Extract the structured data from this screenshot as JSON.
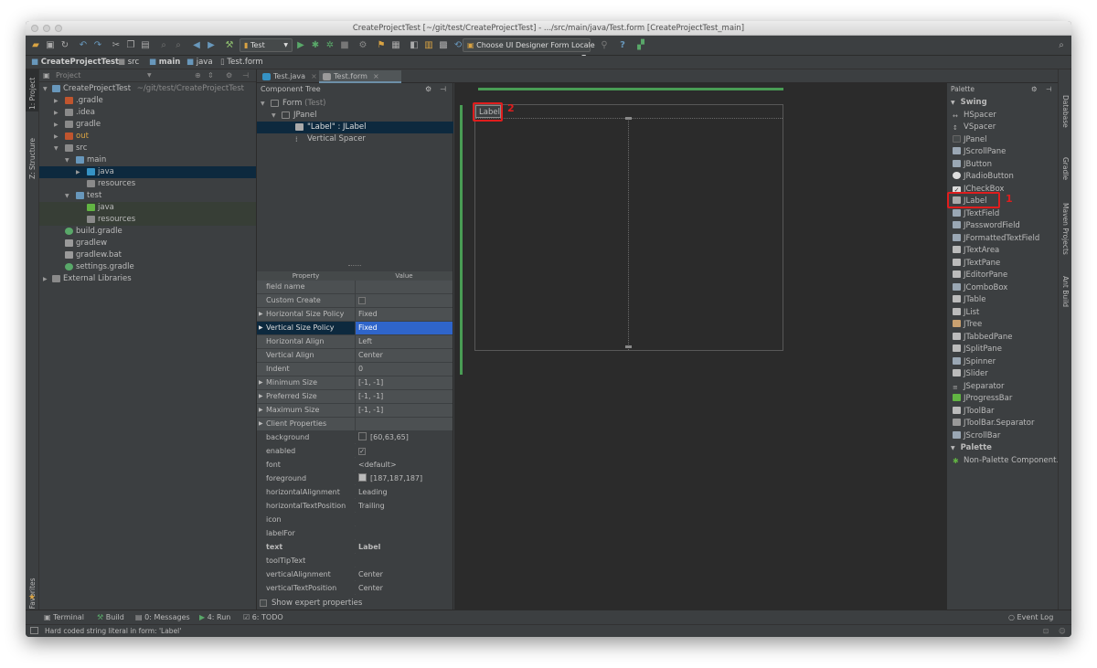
{
  "window": {
    "title": "CreateProjectTest [~/git/test/CreateProjectTest] - .../src/main/java/Test.form [CreateProjectTest_main]"
  },
  "toolbar": {
    "run_config": "Test",
    "locale_combo": "Choose UI Designer Form Locale"
  },
  "navbar": {
    "crumbs": [
      "CreateProjectTest",
      "src",
      "main",
      "java",
      "Test.form"
    ]
  },
  "left_strip": {
    "project": "1: Project",
    "structure": "Z: Structure",
    "favorites": "2: Favorites"
  },
  "right_strip": {
    "database": "Database",
    "gradle": "Gradle",
    "maven": "Maven Projects",
    "ant": "Ant Build"
  },
  "project": {
    "header": "Project",
    "root_name": "CreateProjectTest",
    "root_path": "~/git/test/CreateProjectTest",
    "items": [
      ".gradle",
      ".idea",
      "gradle",
      "out",
      "src",
      "main",
      "java",
      "resources",
      "test",
      "java",
      "resources",
      "build.gradle",
      "gradlew",
      "gradlew.bat",
      "settings.gradle",
      "External Libraries"
    ]
  },
  "tabs": [
    "Test.java",
    "Test.form"
  ],
  "component_tree": {
    "header": "Component Tree",
    "form": "Form",
    "form_suffix": "(Test)",
    "panel": "JPanel",
    "label": "\"Label\" : JLabel",
    "spacer": "Vertical Spacer"
  },
  "properties": {
    "col_property": "Property",
    "col_value": "Value",
    "rows": [
      {
        "name": "field name",
        "value": ""
      },
      {
        "name": "Custom Create",
        "value": ""
      },
      {
        "name": "Horizontal Size Policy",
        "value": "Fixed"
      },
      {
        "name": "Vertical Size Policy",
        "value": "Fixed"
      },
      {
        "name": "Horizontal Align",
        "value": "Left"
      },
      {
        "name": "Vertical Align",
        "value": "Center"
      },
      {
        "name": "Indent",
        "value": "0"
      },
      {
        "name": "Minimum Size",
        "value": "[-1, -1]"
      },
      {
        "name": "Preferred Size",
        "value": "[-1, -1]"
      },
      {
        "name": "Maximum Size",
        "value": "[-1, -1]"
      },
      {
        "name": "Client Properties",
        "value": ""
      },
      {
        "name": "background",
        "value": "[60,63,65]"
      },
      {
        "name": "enabled",
        "value": ""
      },
      {
        "name": "font",
        "value": "<default>"
      },
      {
        "name": "foreground",
        "value": "[187,187,187]"
      },
      {
        "name": "horizontalAlignment",
        "value": "Leading"
      },
      {
        "name": "horizontalTextPosition",
        "value": "Trailing"
      },
      {
        "name": "icon",
        "value": ""
      },
      {
        "name": "labelFor",
        "value": ""
      },
      {
        "name": "text",
        "value": "Label"
      },
      {
        "name": "toolTipText",
        "value": ""
      },
      {
        "name": "verticalAlignment",
        "value": "Center"
      },
      {
        "name": "verticalTextPosition",
        "value": "Center"
      }
    ],
    "show_expert": "Show expert properties"
  },
  "designer": {
    "label_text": "Label",
    "annotation_2": "2"
  },
  "palette": {
    "header": "Palette",
    "swing_group": "Swing",
    "items": [
      "HSpacer",
      "VSpacer",
      "JPanel",
      "JScrollPane",
      "JButton",
      "JRadioButton",
      "JCheckBox",
      "JLabel",
      "JTextField",
      "JPasswordField",
      "JFormattedTextField",
      "JTextArea",
      "JTextPane",
      "JEditorPane",
      "JComboBox",
      "JTable",
      "JList",
      "JTree",
      "JTabbedPane",
      "JSplitPane",
      "JSpinner",
      "JSlider",
      "JSeparator",
      "JProgressBar",
      "JToolBar",
      "JToolBar.Separator",
      "JScrollBar"
    ],
    "palette_group": "Palette",
    "non_palette": "Non-Palette Component...",
    "annotation_1": "1"
  },
  "bottom": {
    "terminal": "Terminal",
    "build": "Build",
    "messages": "0: Messages",
    "run": "4: Run",
    "todo": "6: TODO",
    "event_log": "Event Log"
  },
  "status": {
    "message": "Hard coded string literal in form: 'Label'"
  },
  "colors": {
    "selection": "#2f65ca",
    "accent_green": "#499c54",
    "annotation_red": "#e01d1d",
    "background": "#3c3f41",
    "canvas": "#2b2b2b"
  }
}
